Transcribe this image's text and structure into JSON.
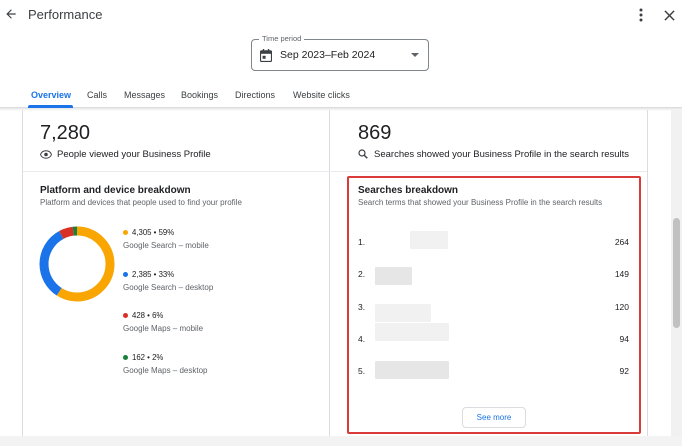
{
  "header": {
    "title": "Performance"
  },
  "period": {
    "legend": "Time period",
    "value": "Sep 2023–Feb 2024"
  },
  "tabs": [
    {
      "label": "Overview",
      "active": true
    },
    {
      "label": "Calls"
    },
    {
      "label": "Messages"
    },
    {
      "label": "Bookings"
    },
    {
      "label": "Directions"
    },
    {
      "label": "Website clicks"
    }
  ],
  "profile_views": {
    "count": "7,280",
    "label": "People viewed your Business Profile",
    "icon": "eye-icon"
  },
  "searches": {
    "count": "869",
    "label": "Searches showed your Business Profile in the search results",
    "icon": "search-icon"
  },
  "platform": {
    "title": "Platform and device breakdown",
    "subtitle": "Platform and devices that people used to find your profile",
    "items": [
      {
        "value": "4,305 • 59%",
        "name": "Google Search – mobile",
        "color": "#f9a602",
        "share": 59
      },
      {
        "value": "2,385 • 33%",
        "name": "Google Search – desktop",
        "color": "#1a73e8",
        "share": 33
      },
      {
        "value": "428 • 6%",
        "name": "Google Maps – mobile",
        "color": "#d93025",
        "share": 6
      },
      {
        "value": "162 • 2%",
        "name": "Google Maps – desktop",
        "color": "#188038",
        "share": 2
      }
    ]
  },
  "search_breakdown": {
    "title": "Searches breakdown",
    "subtitle": "Search terms that showed your Business Profile in the search results",
    "rows": [
      {
        "rank": "1.",
        "count": "264"
      },
      {
        "rank": "2.",
        "count": "149"
      },
      {
        "rank": "3.",
        "count": "120"
      },
      {
        "rank": "4.",
        "count": "94"
      },
      {
        "rank": "5.",
        "count": "92"
      }
    ],
    "see_more": "See more"
  },
  "colors": {
    "accent": "#1a73e8",
    "highlight": "#d93a3a"
  }
}
